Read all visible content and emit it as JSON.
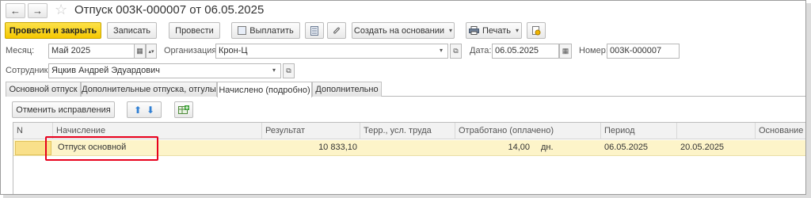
{
  "window": {
    "title": "Отпуск 003К-000007 от 06.05.2025",
    "nav_back": "←",
    "nav_forward": "→",
    "star": "☆"
  },
  "toolbar": {
    "post_and_close": "Провести и закрыть",
    "save": "Записать",
    "post": "Провести",
    "pay": "Выплатить",
    "create_based_on": "Создать на основании",
    "print": "Печать"
  },
  "header_fields": {
    "month_label": "Месяц:",
    "month_value": "Май 2025",
    "org_label": "Организация:",
    "org_value": "Крон-Ц",
    "date_label": "Дата:",
    "date_value": "06.05.2025",
    "number_label": "Номер:",
    "number_value": "003К-000007",
    "employee_label": "Сотрудник:",
    "employee_value": "Яцкив Андрей Эдуардович"
  },
  "tabs": [
    {
      "label": "Основной отпуск",
      "active": false
    },
    {
      "label": "Дополнительные отпуска, отгулы",
      "active": false
    },
    {
      "label": "Начислено (подробно)",
      "active": true
    },
    {
      "label": "Дополнительно",
      "active": false
    }
  ],
  "table_toolbar": {
    "cancel_corrections": "Отменить исправления",
    "up": "⬆",
    "down": "⬇"
  },
  "table": {
    "columns": [
      "N",
      "Начисление",
      "Результат",
      "Терр., усл. труда",
      "Отработано (оплачено)",
      "Период",
      "",
      "Основание"
    ],
    "rows": [
      {
        "n": "",
        "accrual": "Отпуск основной",
        "result": "10 833,10",
        "territory": "",
        "worked": "14,00",
        "worked_unit": "дн.",
        "period_start": "06.05.2025",
        "period_end": "20.05.2025",
        "basis": ""
      }
    ]
  },
  "colors": {
    "primary_button": "#f5c800",
    "selected_row": "#fdf4c9",
    "highlight_box": "#e8001c"
  }
}
